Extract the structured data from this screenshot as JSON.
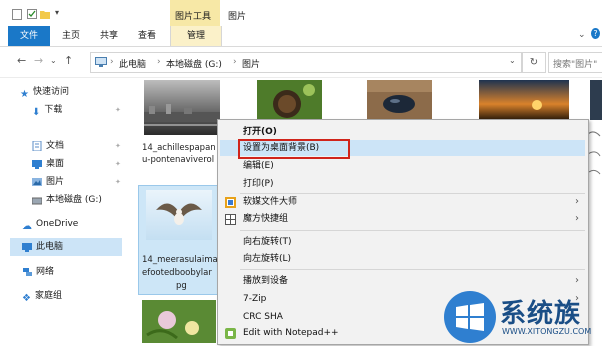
{
  "titlebar": {
    "picture_tools": "图片工具",
    "title": "图片"
  },
  "ribbon": {
    "tabs": [
      "文件",
      "主页",
      "共享",
      "查看",
      "管理"
    ]
  },
  "address": {
    "path": [
      "此电脑",
      "本地磁盘 (G:)",
      "图片"
    ],
    "search_placeholder": "搜索\"图片\""
  },
  "sidebar": {
    "items": [
      "快速访问",
      "下载",
      "文档",
      "桌面",
      "图片",
      "本地磁盘 (G:)",
      "OneDrive",
      "此电脑",
      "网络",
      "家庭组"
    ]
  },
  "files": [
    {
      "caption_line1": "14_achillespapan",
      "caption_line2": "u-pontenaviverol"
    },
    {
      "caption_line1": "14_meerasulaima",
      "caption_line2": "efootedboobylar",
      "caption_line3": "pg"
    }
  ],
  "context_menu": {
    "items": [
      "打开(O)",
      "设置为桌面背景(B)",
      "编辑(E)",
      "打印(P)",
      "软媒文件大师",
      "魔方快捷组",
      "向右旋转(T)",
      "向左旋转(L)",
      "播放到设备",
      "7-Zip",
      "CRC SHA",
      "Edit with Notepad++"
    ],
    "highlighted": "设置为桌面背景(B)"
  },
  "watermark": {
    "brand": "系统族",
    "url": "WWW.XITONGZU.COM"
  },
  "colors": {
    "accent": "#1a78c8",
    "highlight": "#cce4f7",
    "context_tab": "#f7e8a6",
    "red_box": "#d0241b"
  }
}
